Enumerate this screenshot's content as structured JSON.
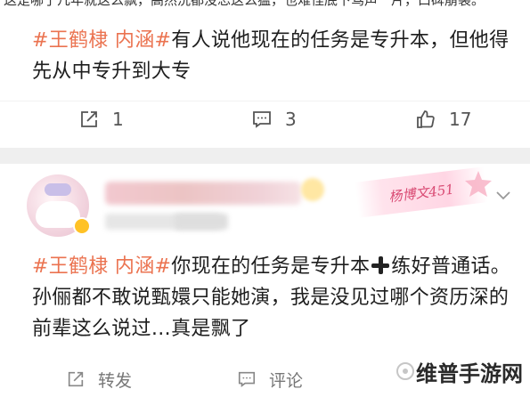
{
  "top_snippet": "这是哪了几年就这么飘，高然洗都没忘这么猛，也难怪底下骂声一片，口碑崩裂。",
  "post1": {
    "hashtag": "#王鹤棣 内涵#",
    "body": "有人说他现在的任务是专升本，但他得先从中专升到大专",
    "actions": {
      "repost": {
        "icon": "share-icon",
        "count": "1"
      },
      "comment": {
        "icon": "comment-icon",
        "count": "3"
      },
      "like": {
        "icon": "thumbs-up-icon",
        "count": "17"
      }
    }
  },
  "post2": {
    "name_tag": "杨博文451",
    "hashtag": "#王鹤棣 内涵#",
    "body_before_plus": "你现在的任务是专升本",
    "body_after_plus": "练好普通话。 孙俪都不敢说甄嬛只能她演，我是没见过哪个资历深的前辈这么说过…真是飘了",
    "actions": {
      "repost": {
        "icon": "share-icon",
        "label": "转发"
      },
      "comment": {
        "icon": "comment-icon",
        "label": "评论"
      }
    }
  },
  "watermark": {
    "text": "维普手游网"
  },
  "colors": {
    "hashtag": "#eb7350",
    "separator": "#efefef",
    "name_tag": "#d94a73"
  }
}
